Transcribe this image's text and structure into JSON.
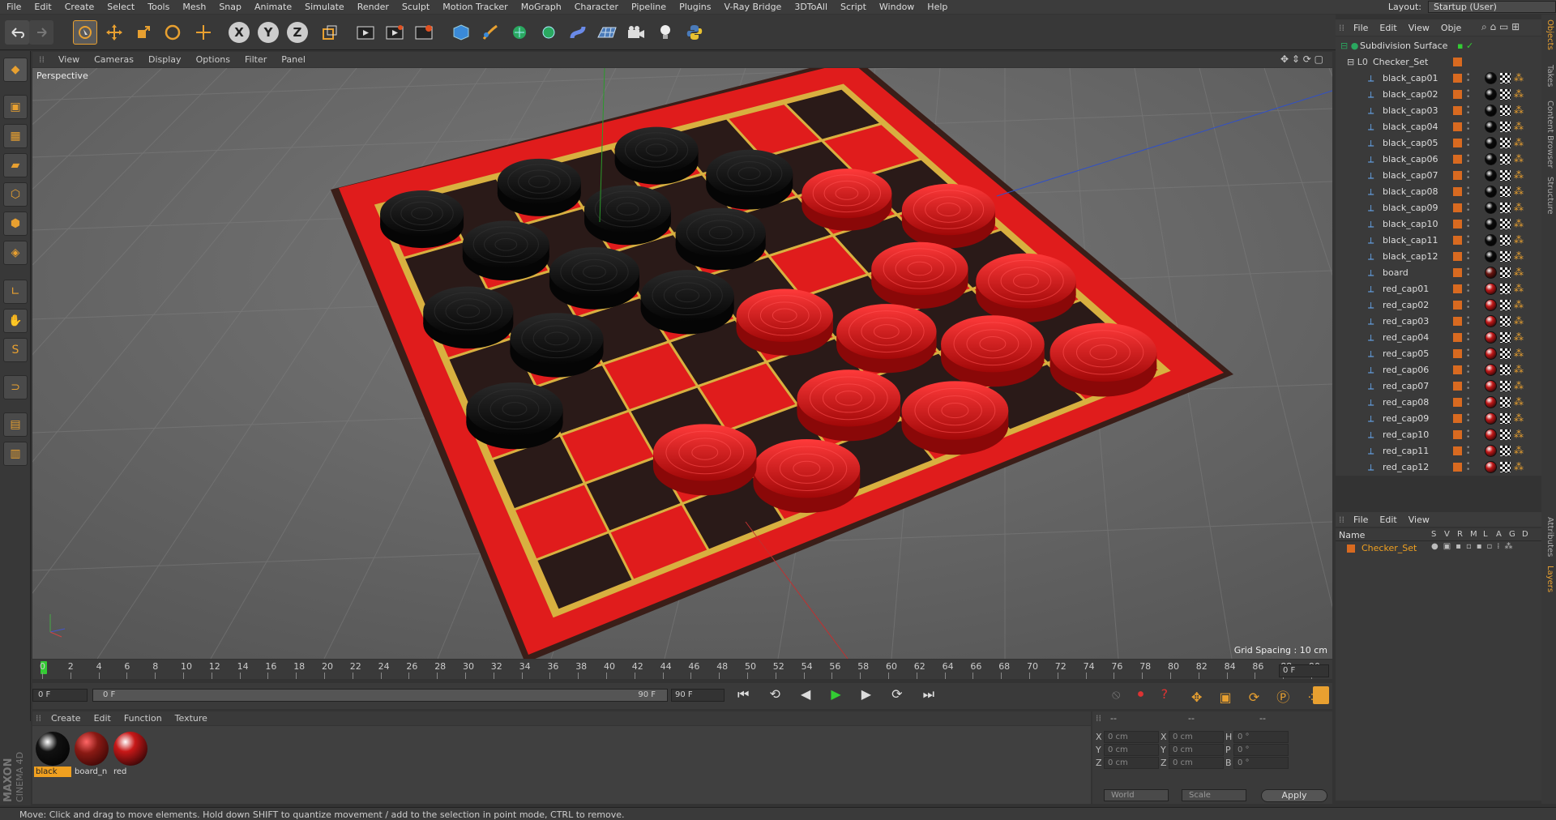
{
  "menubar": {
    "items": [
      "File",
      "Edit",
      "Create",
      "Select",
      "Tools",
      "Mesh",
      "Snap",
      "Animate",
      "Simulate",
      "Render",
      "Sculpt",
      "Motion Tracker",
      "MoGraph",
      "Character",
      "Pipeline",
      "Plugins",
      "V-Ray Bridge",
      "3DToAll",
      "Script",
      "Window",
      "Help"
    ],
    "layout_label": "Layout:",
    "layout_value": "Startup (User)"
  },
  "toolbar": {
    "axis_x": "X",
    "axis_y": "Y",
    "axis_z": "Z"
  },
  "viewport": {
    "menu": [
      "View",
      "Cameras",
      "Display",
      "Options",
      "Filter",
      "Panel"
    ],
    "label": "Perspective",
    "grid_spacing": "Grid Spacing : 10 cm",
    "board_rows": 8,
    "board_cols": 8,
    "black_pieces": 12,
    "red_pieces": 12
  },
  "timeline": {
    "ticks": [
      "0",
      "2",
      "4",
      "6",
      "8",
      "10",
      "12",
      "14",
      "16",
      "18",
      "20",
      "22",
      "24",
      "26",
      "28",
      "30",
      "32",
      "34",
      "36",
      "38",
      "40",
      "42",
      "44",
      "46",
      "48",
      "50",
      "52",
      "54",
      "56",
      "58",
      "60",
      "62",
      "64",
      "66",
      "68",
      "70",
      "72",
      "74",
      "76",
      "78",
      "80",
      "82",
      "84",
      "86",
      "88",
      "90"
    ],
    "current_frame": "0 F",
    "start_frame": "0 F",
    "range_start": "0 F",
    "range_end": "90 F",
    "end_frame": "90 F"
  },
  "materials": {
    "menu": [
      "Create",
      "Edit",
      "Function",
      "Texture"
    ],
    "items": [
      {
        "name": "black",
        "color": "#111111"
      },
      {
        "name": "board_n",
        "color": "#8a1a14"
      },
      {
        "name": "red",
        "color": "#c81818"
      }
    ]
  },
  "coordinates": {
    "header": [
      "--",
      "--",
      "--"
    ],
    "rows": [
      {
        "l1": "X",
        "v1": "0 cm",
        "l2": "X",
        "v2": "0 cm",
        "l3": "H",
        "v3": "0 °"
      },
      {
        "l1": "Y",
        "v1": "0 cm",
        "l2": "Y",
        "v2": "0 cm",
        "l3": "P",
        "v3": "0 °"
      },
      {
        "l1": "Z",
        "v1": "0 cm",
        "l2": "Z",
        "v2": "0 cm",
        "l3": "B",
        "v3": "0 °"
      }
    ],
    "mode": "World",
    "scale": "Scale",
    "apply": "Apply"
  },
  "objects": {
    "menu": [
      "File",
      "Edit",
      "View",
      "Obje"
    ],
    "root": "Subdivision Surface",
    "group": "Checker_Set",
    "items": [
      {
        "name": "black_cap01",
        "mat": "#0a0a0a"
      },
      {
        "name": "black_cap02",
        "mat": "#0a0a0a"
      },
      {
        "name": "black_cap03",
        "mat": "#0a0a0a"
      },
      {
        "name": "black_cap04",
        "mat": "#0a0a0a"
      },
      {
        "name": "black_cap05",
        "mat": "#0a0a0a"
      },
      {
        "name": "black_cap06",
        "mat": "#0a0a0a"
      },
      {
        "name": "black_cap07",
        "mat": "#0a0a0a"
      },
      {
        "name": "black_cap08",
        "mat": "#0a0a0a"
      },
      {
        "name": "black_cap09",
        "mat": "#0a0a0a"
      },
      {
        "name": "black_cap10",
        "mat": "#0a0a0a"
      },
      {
        "name": "black_cap11",
        "mat": "#0a0a0a"
      },
      {
        "name": "black_cap12",
        "mat": "#0a0a0a"
      },
      {
        "name": "board",
        "mat": "#6a1510"
      },
      {
        "name": "red_cap01",
        "mat": "#c01818"
      },
      {
        "name": "red_cap02",
        "mat": "#c01818"
      },
      {
        "name": "red_cap03",
        "mat": "#c01818"
      },
      {
        "name": "red_cap04",
        "mat": "#c01818"
      },
      {
        "name": "red_cap05",
        "mat": "#c01818"
      },
      {
        "name": "red_cap06",
        "mat": "#c01818"
      },
      {
        "name": "red_cap07",
        "mat": "#c01818"
      },
      {
        "name": "red_cap08",
        "mat": "#c01818"
      },
      {
        "name": "red_cap09",
        "mat": "#c01818"
      },
      {
        "name": "red_cap10",
        "mat": "#c01818"
      },
      {
        "name": "red_cap11",
        "mat": "#c01818"
      },
      {
        "name": "red_cap12",
        "mat": "#c01818"
      }
    ]
  },
  "layers": {
    "menu": [
      "File",
      "Edit",
      "View"
    ],
    "header_name": "Name",
    "header_cols": [
      "S",
      "V",
      "R",
      "M",
      "L",
      "A",
      "G",
      "D"
    ],
    "items": [
      "Checker_Set"
    ]
  },
  "side_tabs": [
    "Objects",
    "Takes",
    "Content Browser",
    "Structure",
    "Attributes",
    "Layers"
  ],
  "status": "Move: Click and drag to move elements. Hold down SHIFT to quantize movement / add to the selection in point mode, CTRL to remove.",
  "logo": {
    "brand": "MAXON",
    "product": "CINEMA 4D"
  },
  "colors": {
    "accent": "#e8a030",
    "selected": "#f0a020",
    "board_red": "#e01c1c",
    "board_dark": "#2a1a18",
    "board_line": "#d8b040"
  }
}
